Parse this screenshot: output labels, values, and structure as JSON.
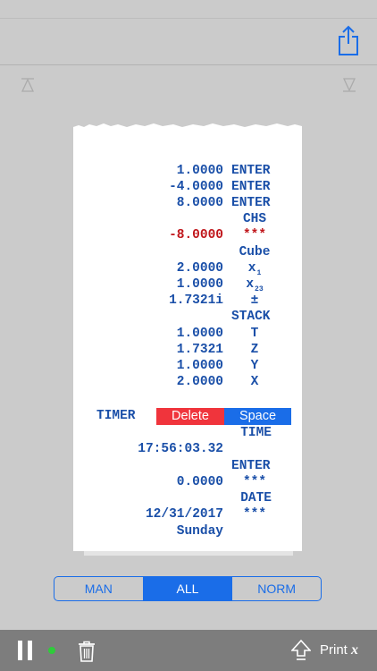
{
  "header": {
    "share_icon": "share-icon"
  },
  "nav": {
    "up_icon": "triangle-up-icon",
    "down_icon": "triangle-down-icon"
  },
  "tape": {
    "lines": [
      {
        "num": "1.0000",
        "op": "ENTER"
      },
      {
        "num": "-4.0000",
        "op": "ENTER"
      },
      {
        "num": "8.0000",
        "op": "ENTER"
      },
      {
        "num": "",
        "op": "CHS"
      },
      {
        "num": "-8.0000",
        "op": "***"
      },
      {
        "num": "",
        "op": "Cube"
      },
      {
        "num": "2.0000",
        "op": "x",
        "sub": "1"
      },
      {
        "num": "1.0000",
        "op": "x",
        "sub": "23"
      },
      {
        "num": "1.7321i",
        "op": "±"
      },
      {
        "num": "",
        "op": "STACK"
      },
      {
        "num": "1.0000",
        "op": "T"
      },
      {
        "num": "1.7321",
        "op": "Z"
      },
      {
        "num": "1.0000",
        "op": "Y"
      },
      {
        "num": "2.0000",
        "op": "X"
      }
    ],
    "timer_label": "TIMER",
    "delete_label": "Delete",
    "space_label": "Space",
    "time_op": "TIME",
    "time_value": "17:56:03.32",
    "enter_op": "ENTER",
    "zero_value": "0.0000",
    "zero_op": "***",
    "date_op": "DATE",
    "date_value": "12/31/2017",
    "date_marker": "***",
    "weekday": "Sunday"
  },
  "mode_selector": {
    "options": [
      "MAN",
      "ALL",
      "NORM"
    ],
    "selected": "ALL"
  },
  "toolbar": {
    "print_label": "Print",
    "print_var": "x",
    "status_color": "#2ecc3a"
  },
  "colors": {
    "accent": "#1a6de8",
    "tape_text": "#1a4fa8",
    "error_text": "#c0161b",
    "delete": "#f0343c"
  }
}
